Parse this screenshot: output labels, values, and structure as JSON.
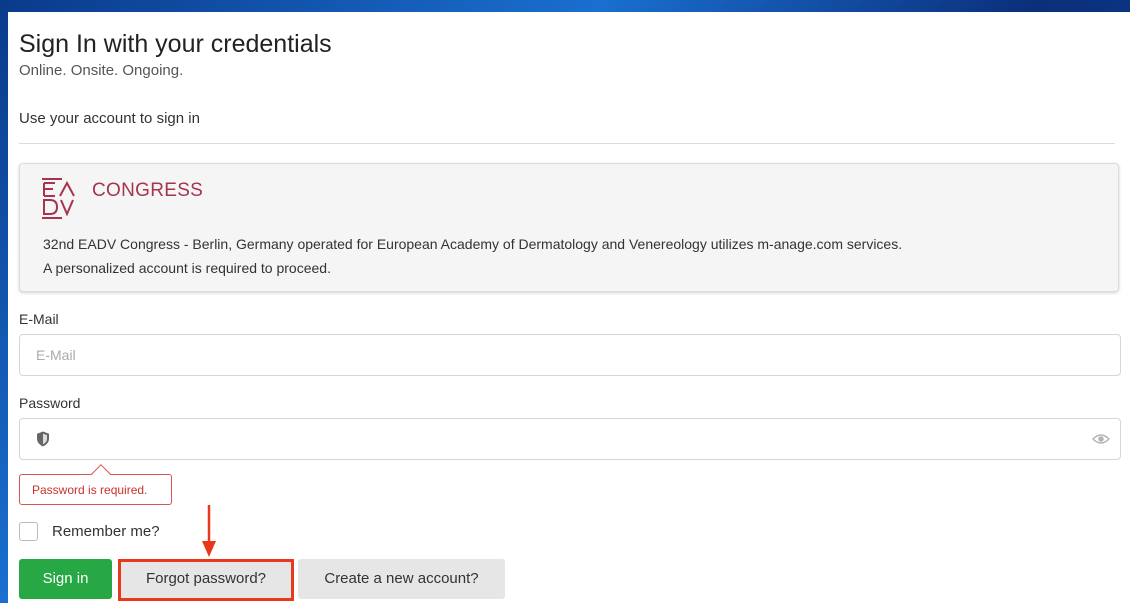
{
  "page": {
    "title": "Sign In with your credentials",
    "subtitle": "Online. Onsite. Ongoing.",
    "intro": "Use your account to sign in"
  },
  "info": {
    "logo_text": "CONGRESS",
    "logo_mark": "EADV",
    "line1": "32nd EADV Congress - Berlin, Germany operated for European Academy of Dermatology and Venereology utilizes m-anage.com services.",
    "line2": "A personalized account is required to proceed.",
    "brand_color": "#a7344f"
  },
  "form": {
    "email_label": "E-Mail",
    "email_placeholder": "E-Mail",
    "password_label": "Password",
    "password_value": "",
    "password_error": "Password is required.",
    "remember_label": "Remember me?",
    "remember_checked": false
  },
  "buttons": {
    "signin": "Sign in",
    "forgot": "Forgot password?",
    "create": "Create a new account?"
  },
  "icons": {
    "password_prefix": "shield-icon",
    "password_toggle": "eye-icon"
  },
  "colors": {
    "primary": "#28a745",
    "error": "#d9534f",
    "highlight": "#e8391d"
  }
}
